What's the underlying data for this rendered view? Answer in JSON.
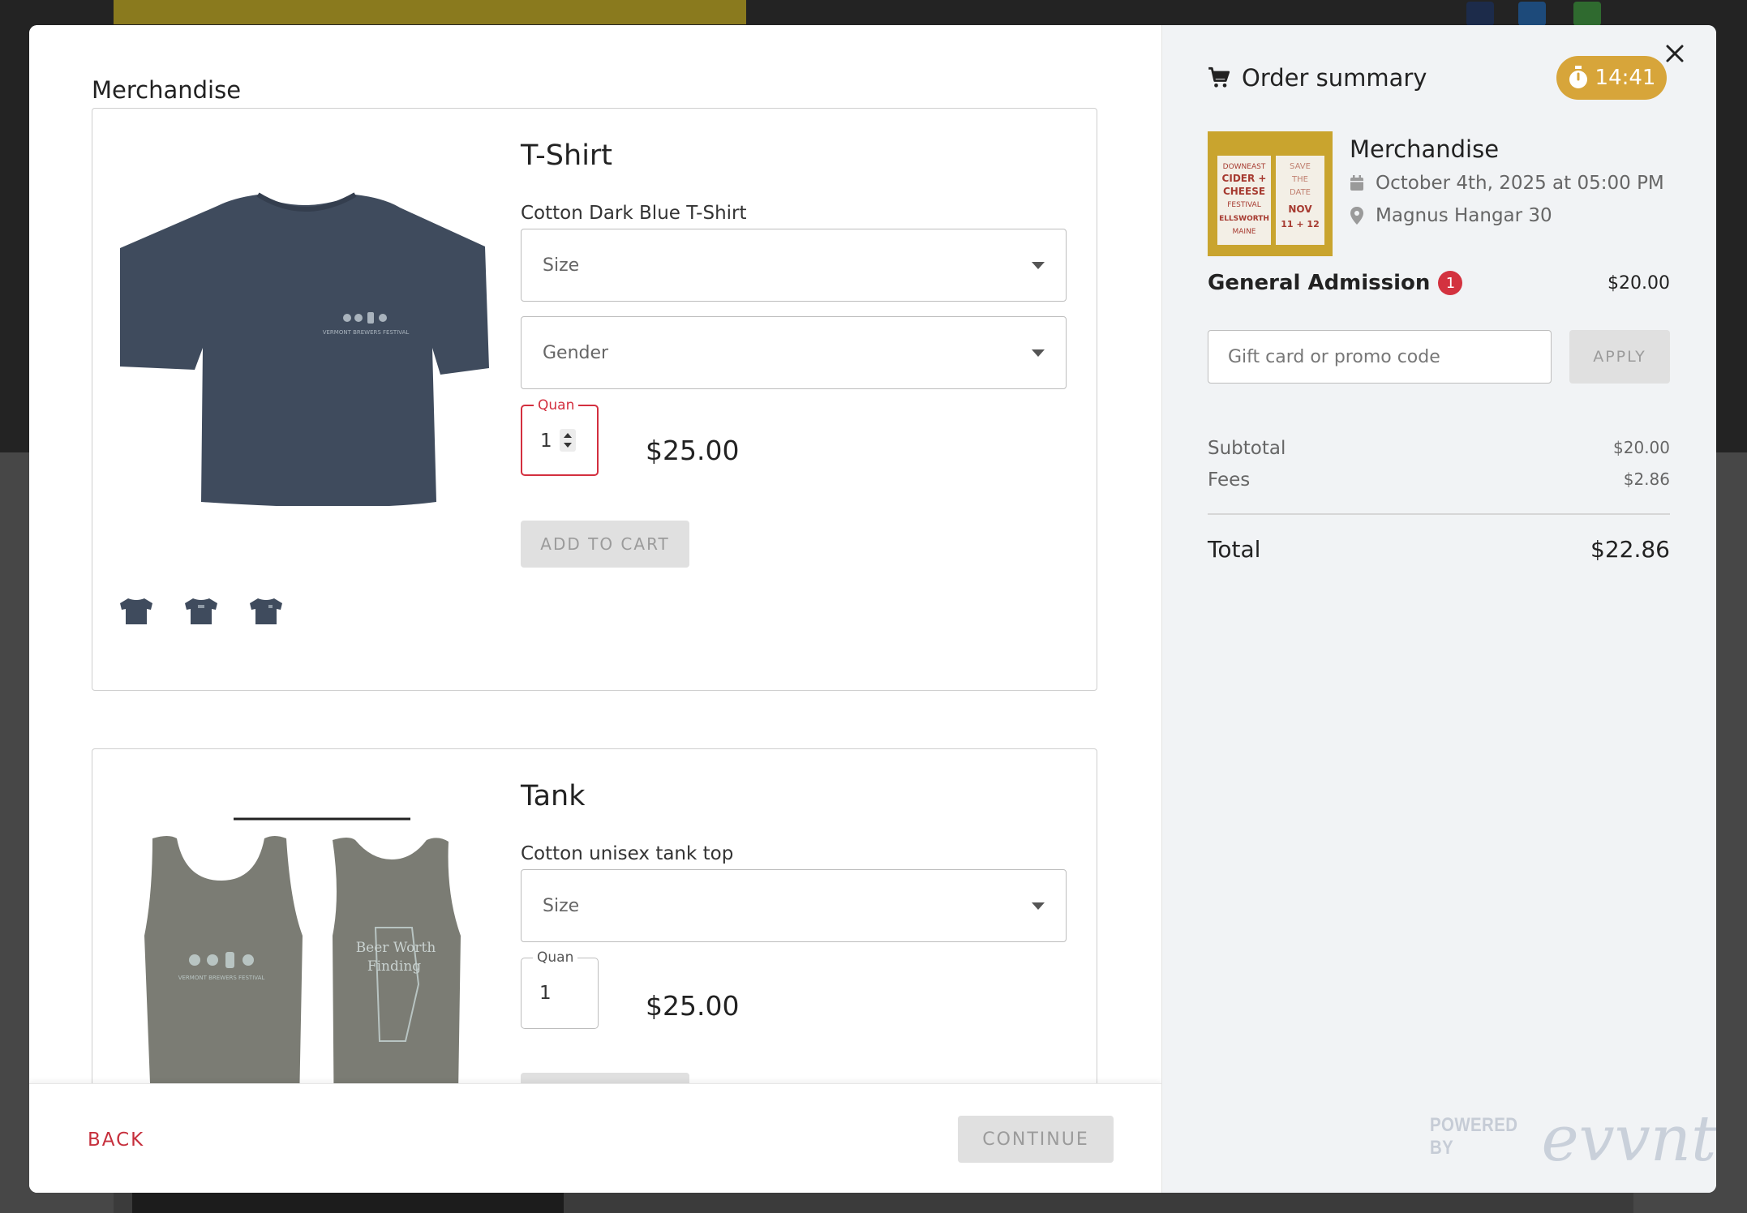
{
  "left": {
    "section_title": "Merchandise",
    "products": [
      {
        "name": "T-Shirt",
        "description": "Cotton Dark Blue T-Shirt",
        "size_placeholder": "Size",
        "gender_placeholder": "Gender",
        "quantity_label": "Quan",
        "quantity_value": "1",
        "price": "$25.00",
        "add_to_cart": "ADD TO CART",
        "shirt_color": "#3f4b5d",
        "print_text": "VERMONT BREWERS FESTIVAL"
      },
      {
        "name": "Tank",
        "description": "Cotton unisex tank top",
        "size_placeholder": "Size",
        "quantity_label": "Quan",
        "quantity_value": "1",
        "price": "$25.00",
        "tank_color": "#7b7c74",
        "print_front": "VERMONT BREWERS FESTIVAL",
        "print_back_line1": "Beer Worth",
        "print_back_line2": "Finding"
      }
    ],
    "footer": {
      "back_label": "BACK",
      "continue_label": "CONTINUE"
    }
  },
  "summary": {
    "title": "Order summary",
    "timer": "14:41",
    "event": {
      "name": "Merchandise",
      "date": "October 4th, 2025 at 05:00 PM",
      "location": "Magnus Hangar 30",
      "image_text": {
        "downeast": "DOWNEAST",
        "cider": "CIDER +",
        "cheese": "CHEESE",
        "festival": "FESTIVAL",
        "ellsworth": "ELLSWORTH",
        "maine": "MAINE",
        "save": "SAVE",
        "the": "THE",
        "date": "DATE",
        "nov": "NOV",
        "days": "11 + 12"
      }
    },
    "ticket": {
      "label": "General Admission",
      "count": "1",
      "price": "$20.00"
    },
    "promo_placeholder": "Gift card or promo code",
    "apply_label": "APPLY",
    "subtotal_label": "Subtotal",
    "subtotal_value": "$20.00",
    "fees_label": "Fees",
    "fees_value": "$2.86",
    "total_label": "Total",
    "total_value": "$22.86",
    "powered_by": "POWERED BY",
    "brand": "evvnt"
  },
  "colors": {
    "accent_red": "#d3323f",
    "timer_gold": "#d7a53a"
  }
}
